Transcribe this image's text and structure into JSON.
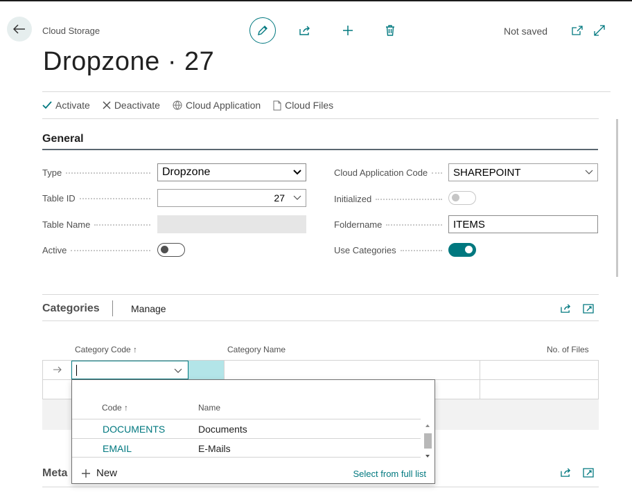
{
  "header": {
    "breadcrumb": "Cloud Storage",
    "title": "Dropzone · 27",
    "status": "Not saved"
  },
  "actions": [
    "Activate",
    "Deactivate",
    "Cloud Application",
    "Cloud Files"
  ],
  "general": {
    "section_title": "General",
    "type_label": "Type",
    "type_value": "Dropzone",
    "table_id_label": "Table ID",
    "table_id_value": "27",
    "table_name_label": "Table Name",
    "table_name_value": "",
    "active_label": "Active",
    "active_value": false,
    "cloud_app_code_label": "Cloud Application Code",
    "cloud_app_code_value": "SHAREPOINT",
    "initialized_label": "Initialized",
    "initialized_value": false,
    "foldername_label": "Foldername",
    "foldername_value": "ITEMS",
    "use_categories_label": "Use Categories",
    "use_categories_value": true
  },
  "categories": {
    "section_title": "Categories",
    "manage_label": "Manage",
    "columns": [
      "Category Code ↑",
      "Category Name",
      "No. of Files"
    ],
    "current_code_value": ""
  },
  "lookup": {
    "columns": [
      "Code ↑",
      "Name"
    ],
    "rows": [
      {
        "code": "DOCUMENTS",
        "name": "Documents"
      },
      {
        "code": "EMAIL",
        "name": "E-Mails"
      }
    ],
    "new_label": "New",
    "full_list_label": "Select from full list"
  },
  "meta": {
    "section_title": "Meta"
  },
  "colors": {
    "accent": "#00787f",
    "highlight": "#b3e5e8"
  }
}
